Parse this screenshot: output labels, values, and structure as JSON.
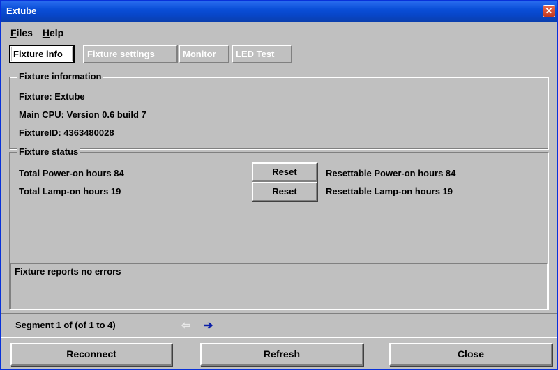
{
  "window": {
    "title": "Extube",
    "close_glyph": "✕"
  },
  "menu": {
    "items": [
      {
        "label_u": "F",
        "label_rest": "iles"
      },
      {
        "label_u": "H",
        "label_rest": "elp"
      }
    ]
  },
  "tabs": [
    "Fixture info",
    "Fixture settings",
    "Monitor",
    "LED Test"
  ],
  "fixture_information": {
    "title": "Fixture information",
    "fixture": "Fixture: Extube",
    "cpu": "Main CPU: Version 0.6 build 7",
    "fixture_id": "FixtureID: 4363480028"
  },
  "fixture_status": {
    "title": "Fixture status",
    "rows": [
      {
        "label": "Total Power-on hours 84",
        "button": "Reset",
        "resettable": "Resettable Power-on hours 84"
      },
      {
        "label": "Total Lamp-on hours 19",
        "button": "Reset",
        "resettable": "Resettable Lamp-on hours 19"
      }
    ]
  },
  "errors": {
    "message": "Fixture reports no errors"
  },
  "segment": {
    "text": "Segment 1 of (of 1 to 4)",
    "prev_icon": "arrow-left-icon",
    "next_icon": "arrow-right-icon"
  },
  "buttons": {
    "reconnect": "Reconnect",
    "refresh": "Refresh",
    "close": "Close"
  },
  "colors": {
    "titlebar": "#0a4fd8",
    "window_bg": "#c0c0c0",
    "next_arrow": "#0a1ea8"
  }
}
